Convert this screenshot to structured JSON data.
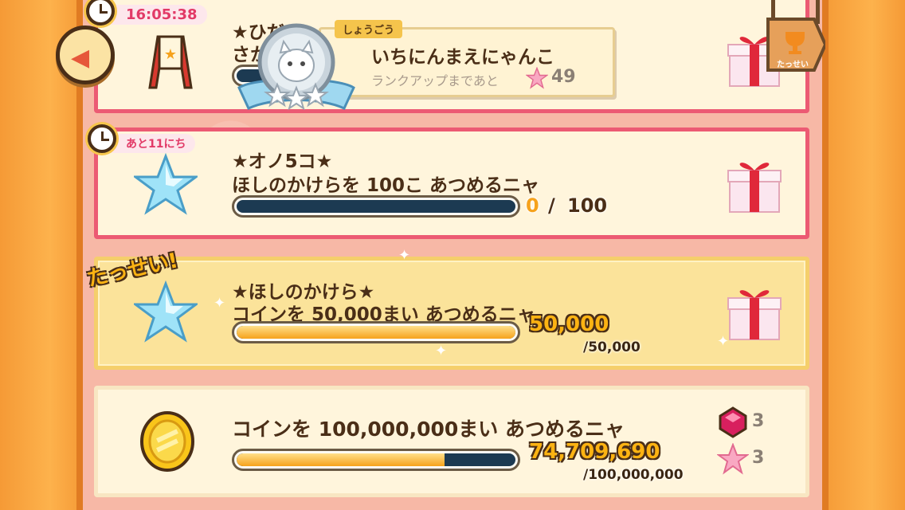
{
  "clock_time": "16:05:38",
  "rank": {
    "label": "しょうごう",
    "name": "いちにんまえにゃんこ",
    "hint": "ランクアップまであと",
    "remaining": "49"
  },
  "sign": {
    "label": "たっせい"
  },
  "missions": [
    {
      "title": "★ひだ",
      "desc": "さか",
      "status": "pending"
    },
    {
      "tag": "あと11にち",
      "title": "★オノ5コ★",
      "desc": "ほしのかけらを 100こ あつめるニャ",
      "current": "0",
      "separator": "/",
      "goal": "100",
      "progress": 0,
      "status": "pending"
    },
    {
      "stamp": "たっせい!",
      "title": "★ほしのかけら★",
      "desc": "コインを 50,000まい あつめるニャ",
      "current": "50,000",
      "goal": "/50,000",
      "progress": 1.0,
      "status": "achieved"
    },
    {
      "desc": "コインを 100,000,000まい あつめるニャ",
      "current": "74,709,690",
      "goal": "/100,000,000",
      "progress": 0.747,
      "rewards": [
        {
          "icon": "ruby-gem-icon",
          "amount": "3"
        },
        {
          "icon": "pink-star-icon",
          "amount": "3"
        }
      ],
      "status": "in-progress"
    }
  ],
  "colors": {
    "pending_border": "#ec5a73",
    "achieved_bg": "#fbe39a",
    "bar_fill": "#f6a21c",
    "bar_track": "#1c3a52",
    "frame": "#f59a36"
  }
}
